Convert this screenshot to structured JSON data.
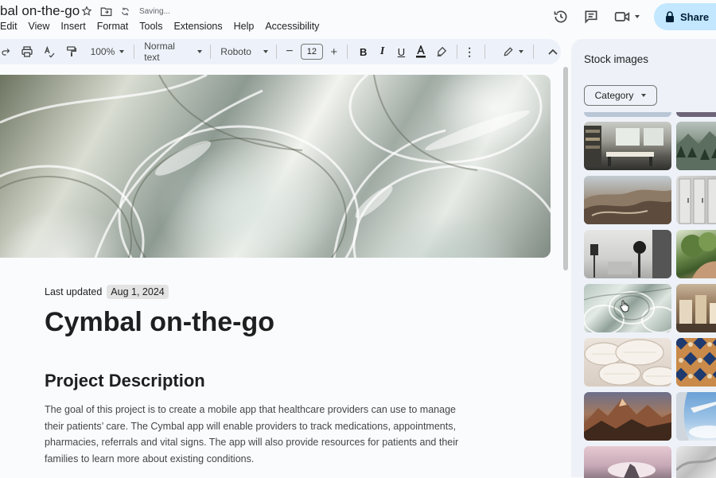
{
  "titlebar": {
    "doc_title": "bal on-the-go",
    "saving_text": "Saving...",
    "share_label": "Share"
  },
  "menu": [
    "Edit",
    "View",
    "Insert",
    "Format",
    "Tools",
    "Extensions",
    "Help",
    "Accessibility"
  ],
  "toolbar": {
    "zoom": "100%",
    "style": "Normal text",
    "font": "Roboto",
    "font_size": "12"
  },
  "document": {
    "last_updated_label": "Last updated",
    "last_updated_date": "Aug 1, 2024",
    "title": "Cymbal on-the-go",
    "section_heading": "Project Description",
    "paragraph_lines": [
      "The goal of this project is to create a mobile app that healthcare providers can use to manage",
      "their patients’ care.  The Cymbal app will enable providers to track medications, appointments,",
      "pharmacies, referrals and vital signs. The app will also provide resources for patients and their",
      "families to learn more about existing conditions."
    ]
  },
  "side_panel": {
    "title": "Stock images",
    "category_label": "Category"
  },
  "colors": {
    "share_bg": "#c2e7ff",
    "toolbar_bg": "#edf2fa",
    "panel_bg": "#eef2f8"
  }
}
